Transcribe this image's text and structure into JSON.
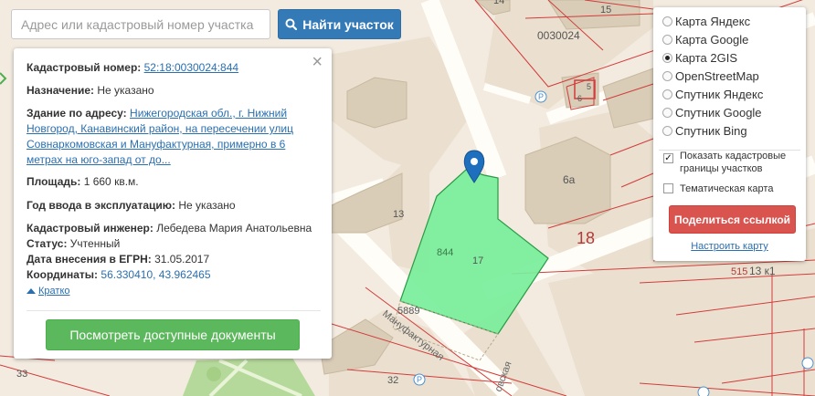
{
  "search": {
    "placeholder": "Адрес или кадастровый номер участка",
    "button_label": "Найти участок"
  },
  "info": {
    "cad_label": "Кадастровый номер:",
    "cad_value": "52:18:0030024:844",
    "purpose_label": "Назначение:",
    "purpose_value": "Не указано",
    "address_label": "Здание по адресу:",
    "address_value": "Нижегородская обл., г. Нижний Новгород, Канавинский район, на пересечении улиц Совнаркомовская и Мануфактурная, примерно в 6 метрах на юго-запад от до...",
    "area_label": "Площадь:",
    "area_value": "1 660 кв.м.",
    "year_label": "Год ввода в эксплуатацию:",
    "year_value": "Не указано",
    "engineer_label": "Кадастровый инженер:",
    "engineer_value": "Лебедева Мария Анатольевна",
    "status_label": "Статус:",
    "status_value": "Учтенный",
    "date_label": "Дата внесения в ЕГРН:",
    "date_value": "31.05.2017",
    "coords_label": "Координаты:",
    "coords_value": "56.330410, 43.962465",
    "collapse_label": "Кратко",
    "docs_button": "Посмотреть доступные документы"
  },
  "layers": {
    "options": [
      "Карта Яндекс",
      "Карта Google",
      "Карта 2GIS",
      "OpenStreetMap",
      "Спутник Яндекс",
      "Спутник Google",
      "Спутник Bing"
    ],
    "selected": "Карта 2GIS",
    "show_boundaries": "Показать кадастровые границы участков",
    "show_boundaries_checked": true,
    "thematic": "Тематическая карта",
    "thematic_checked": false,
    "share_button": "Поделиться ссылкой",
    "configure_link": "Настроить карту"
  },
  "map": {
    "labels": {
      "quarter": "0030024",
      "b15": "15",
      "b14": "14",
      "b5": "5",
      "b6": "6",
      "b6a": "6а",
      "b18": "18",
      "b13": "13",
      "b844": "844",
      "b17": "17",
      "b5889": "5889",
      "b515": "515",
      "b13k1": "13 к1",
      "b33": "33",
      "b32": "32",
      "street1": "Мануфактурная",
      "street2": "овская"
    },
    "colors": {
      "parcel_fill": "#78ee9a",
      "parcel_stroke": "#2a9b45",
      "boundary": "#d23c3c",
      "marker": "#1f6fbf"
    }
  }
}
